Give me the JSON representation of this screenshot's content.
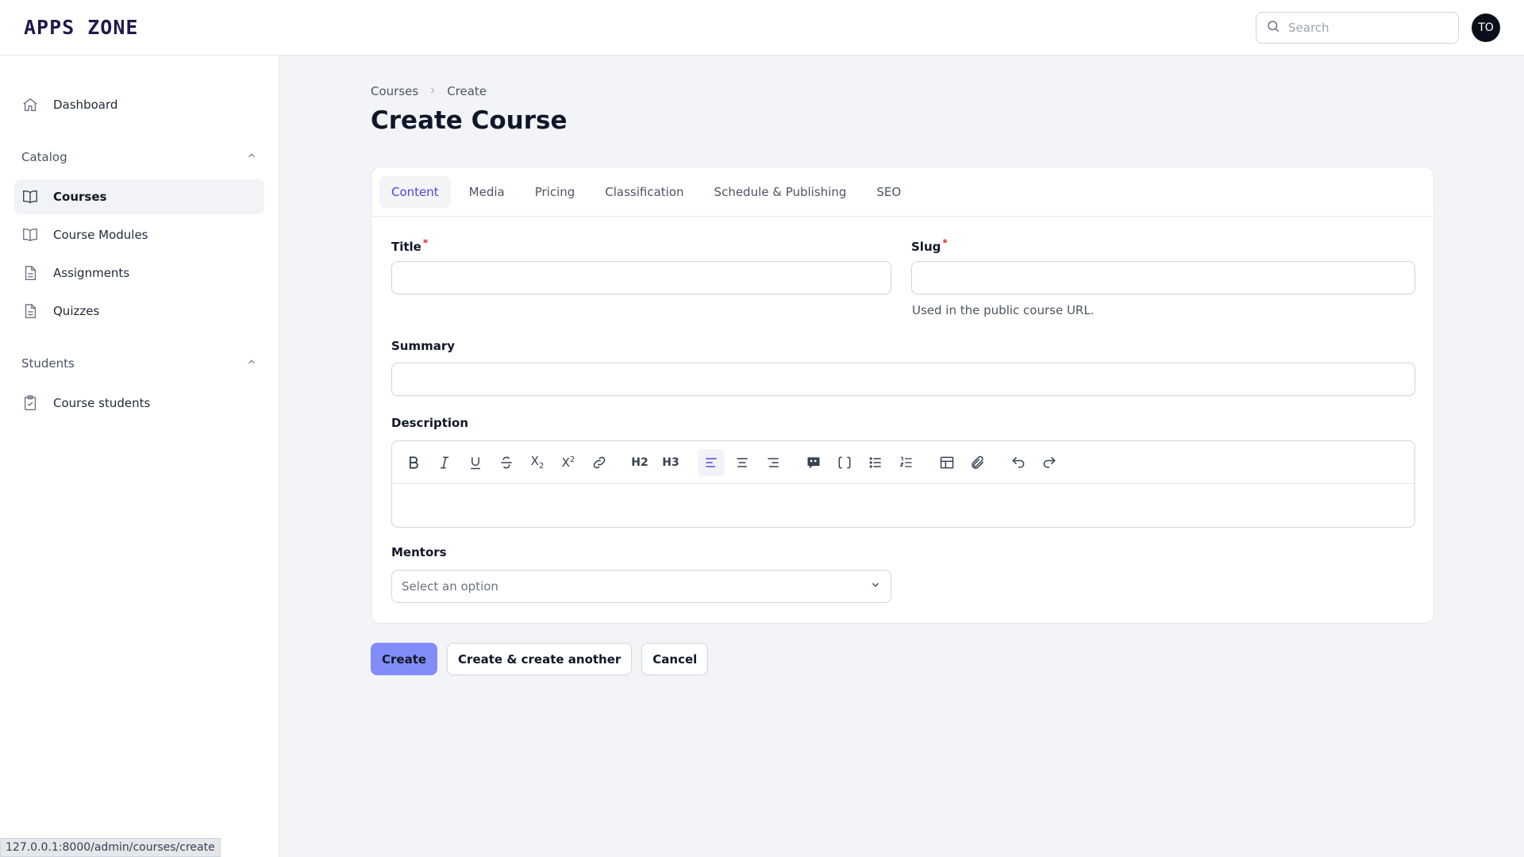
{
  "header": {
    "brand": "APPS ZONE",
    "search_placeholder": "Search",
    "avatar_initials": "TO"
  },
  "sidebar": {
    "dashboard": "Dashboard",
    "groups": [
      {
        "label": "Catalog",
        "items": [
          "Courses",
          "Course Modules",
          "Assignments",
          "Quizzes"
        ]
      },
      {
        "label": "Students",
        "items": [
          "Course students"
        ]
      }
    ]
  },
  "breadcrumb": {
    "parent": "Courses",
    "current": "Create"
  },
  "page": {
    "title": "Create Course"
  },
  "tabs": [
    "Content",
    "Media",
    "Pricing",
    "Classification",
    "Schedule & Publishing",
    "SEO"
  ],
  "form": {
    "title_label": "Title",
    "title_value": "",
    "slug_label": "Slug",
    "slug_value": "",
    "slug_hint": "Used in the public course URL.",
    "summary_label": "Summary",
    "summary_value": "",
    "description_label": "Description",
    "mentors_label": "Mentors",
    "mentors_placeholder": "Select an option",
    "required_mark": "*"
  },
  "toolbar_icons": [
    "bold-icon",
    "italic-icon",
    "underline-icon",
    "strike-icon",
    "subscript-icon",
    "superscript-icon",
    "link-icon",
    "h2-icon",
    "h3-icon",
    "align-left-icon",
    "align-center-icon",
    "align-right-icon",
    "blockquote-icon",
    "code-block-icon",
    "bullet-list-icon",
    "ordered-list-icon",
    "table-icon",
    "attach-icon",
    "undo-icon",
    "redo-icon"
  ],
  "toolbar_text": {
    "h2": "H2",
    "h3": "H3",
    "sub": "X",
    "sup": "X"
  },
  "actions": {
    "create": "Create",
    "create_another": "Create & create another",
    "cancel": "Cancel"
  },
  "statusbar": {
    "url": "127.0.0.1:8000/admin/courses/create"
  },
  "colors": {
    "accent": "#4f46e5",
    "primary_button": "#818cf8",
    "required": "#dc2626"
  }
}
